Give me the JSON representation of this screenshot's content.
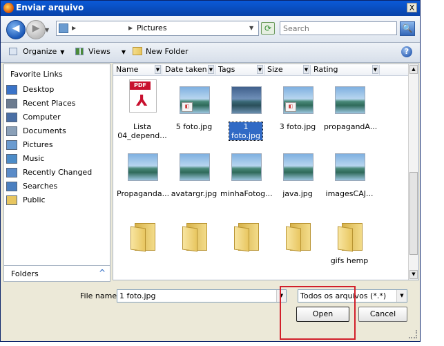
{
  "window": {
    "title": "Enviar arquivo",
    "close_glyph": "X"
  },
  "nav": {
    "back_glyph": "◀",
    "forward_glyph": "▶",
    "location": "Pictures",
    "refresh_glyph": "⟳",
    "search_placeholder": "Search",
    "search_glyph": "🔍"
  },
  "toolbar": {
    "organize": "Organize",
    "views": "Views",
    "new_folder": "New Folder",
    "help_glyph": "?"
  },
  "sidebar": {
    "heading": "Favorite Links",
    "items": [
      {
        "label": "Desktop",
        "icon": "desktop-icon",
        "color": "#3a73c8"
      },
      {
        "label": "Recent Places",
        "icon": "recent-places-icon",
        "color": "#6b7b8f"
      },
      {
        "label": "Computer",
        "icon": "computer-icon",
        "color": "#4a6fa5"
      },
      {
        "label": "Documents",
        "icon": "documents-icon",
        "color": "#8aa0b8"
      },
      {
        "label": "Pictures",
        "icon": "pictures-icon",
        "color": "#6a9bd0"
      },
      {
        "label": "Music",
        "icon": "music-icon",
        "color": "#4c8cc8"
      },
      {
        "label": "Recently Changed",
        "icon": "recently-changed-icon",
        "color": "#5a8bc8"
      },
      {
        "label": "Searches",
        "icon": "searches-icon",
        "color": "#4a7fc0"
      },
      {
        "label": "Public",
        "icon": "public-folder-icon",
        "color": "#e8c660"
      }
    ],
    "folders_label": "Folders",
    "folders_caret": "^"
  },
  "columns": [
    "Name",
    "Date taken",
    "Tags",
    "Size",
    "Rating"
  ],
  "files": [
    {
      "label": "Lista 04_depend...",
      "type": "pdf",
      "selected": false
    },
    {
      "label": "5 foto.jpg",
      "type": "image",
      "selected": false
    },
    {
      "label": "1 foto.jpg",
      "type": "image",
      "selected": true
    },
    {
      "label": "3 foto.jpg",
      "type": "image",
      "selected": false
    },
    {
      "label": "propagandA...",
      "type": "image",
      "selected": false
    },
    {
      "label": "Propaganda...",
      "type": "image",
      "selected": false
    },
    {
      "label": "avatargr.jpg",
      "type": "image",
      "selected": false
    },
    {
      "label": "minhaFotog...",
      "type": "image",
      "selected": false
    },
    {
      "label": "java.jpg",
      "type": "image",
      "selected": false
    },
    {
      "label": "imagesCAJ...",
      "type": "image",
      "selected": false
    },
    {
      "label": "",
      "type": "folder",
      "selected": false
    },
    {
      "label": "",
      "type": "folder",
      "selected": false
    },
    {
      "label": "",
      "type": "folder",
      "selected": false
    },
    {
      "label": "",
      "type": "folder",
      "selected": false
    },
    {
      "label": "gifs hemp",
      "type": "folder",
      "selected": false
    }
  ],
  "pdf_badge": "PDF",
  "footer": {
    "file_name_label": "File name:",
    "file_name_value": "1 foto.jpg",
    "file_type_value": "Todos os arquivos (*.*)",
    "open_label": "Open",
    "cancel_label": "Cancel"
  },
  "colors": {
    "highlight": "#d21f2a",
    "title_bar": "#0a5ad8",
    "selection": "#316ac5"
  }
}
